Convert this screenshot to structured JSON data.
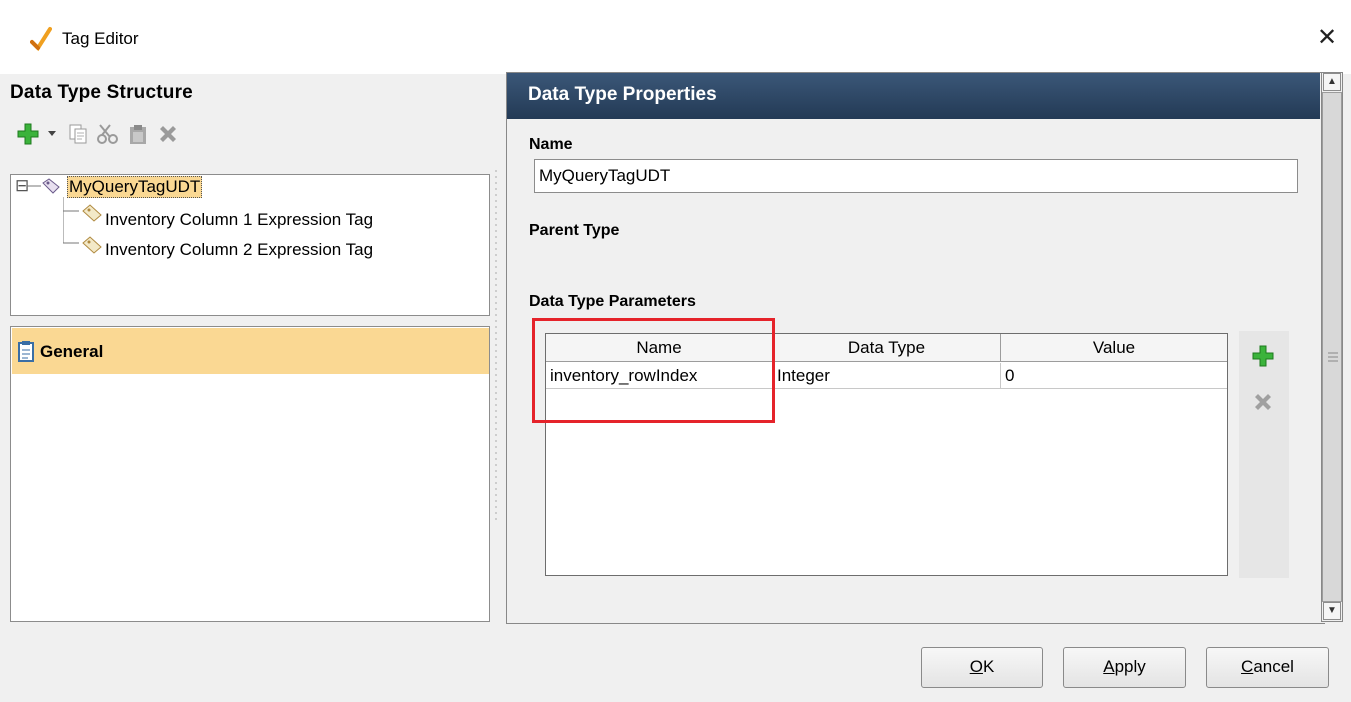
{
  "window": {
    "title": "Tag Editor",
    "close_glyph": "✕"
  },
  "left": {
    "title": "Data Type Structure",
    "toolbar": [
      "add-icon",
      "dropdown-arrow-icon",
      "copy-icon",
      "cut-icon",
      "paste-icon",
      "delete-icon"
    ],
    "tree": {
      "expander": "⊟",
      "root": "MyQueryTagUDT",
      "children": [
        "Inventory Column 1 Expression Tag",
        "Inventory Column 2 Expression Tag"
      ]
    },
    "category": "General"
  },
  "right": {
    "header": "Data Type Properties",
    "name_label": "Name",
    "name_value": "MyQueryTagUDT",
    "parent_label": "Parent Type",
    "params_label": "Data Type Parameters",
    "table": {
      "columns": [
        "Name",
        "Data Type",
        "Value"
      ],
      "rows": [
        [
          "inventory_rowIndex",
          "Integer",
          "0"
        ]
      ]
    }
  },
  "buttons": {
    "ok": {
      "mnemonic": "O",
      "rest": "K"
    },
    "apply": {
      "mnemonic": "A",
      "rest": "pply"
    },
    "cancel": {
      "mnemonic": "C",
      "rest": "ancel"
    }
  },
  "colors": {
    "header_bg": "#2b4563",
    "selection": "#fad893",
    "highlight": "#e5232a",
    "add_green": "#2fa52f"
  }
}
